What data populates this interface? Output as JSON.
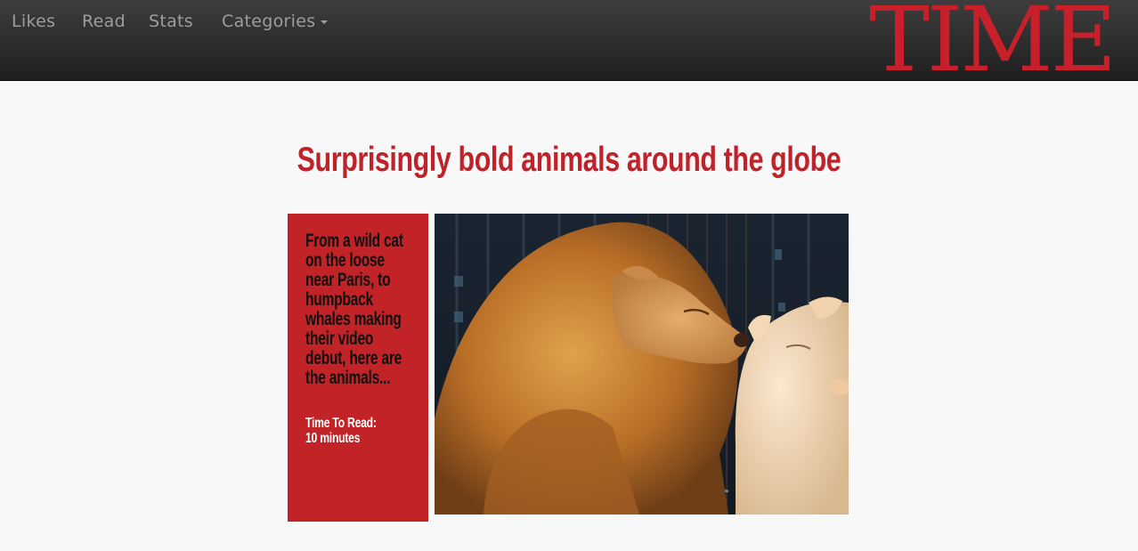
{
  "nav": {
    "items": [
      {
        "label": "Likes"
      },
      {
        "label": "Read"
      },
      {
        "label": "Stats"
      },
      {
        "label": "Categories"
      }
    ],
    "logo": "TIME"
  },
  "article": {
    "headline": "Surprisingly bold animals around the globe",
    "summary": "From a wild cat on the loose near Paris, to humpback whales making their video debut, here are the animals...",
    "read_label": "Time To Read:",
    "read_value": "10 minutes"
  },
  "colors": {
    "brand_red": "#c8202b",
    "card_red": "#c12326",
    "nav_text": "#9d9d9d",
    "page_bg": "#f8f8f8"
  }
}
